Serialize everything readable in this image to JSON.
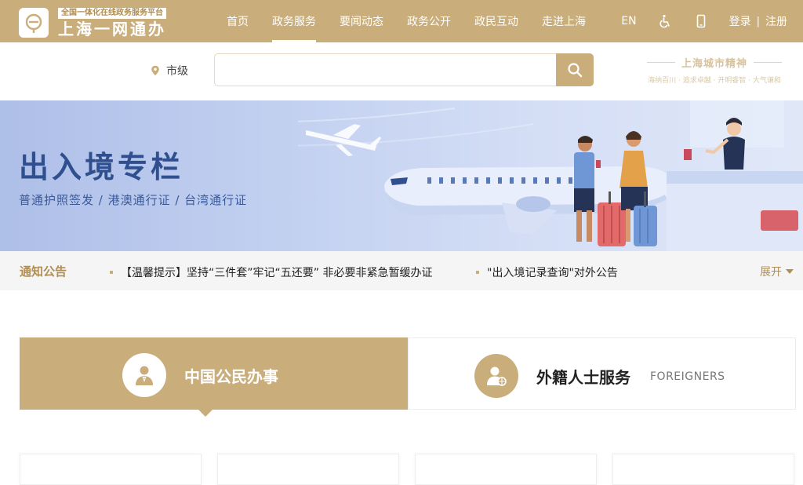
{
  "header": {
    "logo_tagline": "全国一体化在线政务服务平台",
    "logo_name": "上海一网通办",
    "nav": [
      {
        "label": "首页"
      },
      {
        "label": "政务服务",
        "active": true
      },
      {
        "label": "要闻动态"
      },
      {
        "label": "政务公开"
      },
      {
        "label": "政民互动"
      },
      {
        "label": "走进上海"
      }
    ],
    "lang": "EN",
    "accessibility_icon": "wheelchair-icon",
    "mobile_icon": "mobile-phone-icon",
    "login": "登录",
    "separator": "|",
    "register": "注册"
  },
  "search": {
    "region": "市级",
    "region_icon": "location-pin-icon",
    "placeholder": "",
    "button_icon": "search-icon",
    "spirit_title": "上海城市精神",
    "spirit_sub": "海纳百川 · 追求卓越 · 开明睿智 · 大气谦和"
  },
  "banner": {
    "title": "出入境专栏",
    "subtitle": "普通护照签发 / 港澳通行证 / 台湾通行证"
  },
  "notice": {
    "label": "通知公告",
    "items": [
      "【温馨提示】坚持“三件套”牢记“五还要” 非必要非紧急暂缓办证",
      "\"出入境记录查询\"对外公告"
    ],
    "more": "展开"
  },
  "tabs": [
    {
      "label": "中国公民办事",
      "active": true,
      "icon": "citizen-icon"
    },
    {
      "label": "外籍人士服务",
      "en": "FOREIGNERS",
      "icon": "foreigner-icon"
    }
  ],
  "colors": {
    "brand_gold": "#c9ad7b",
    "banner_blue": "#2f4f8f"
  }
}
